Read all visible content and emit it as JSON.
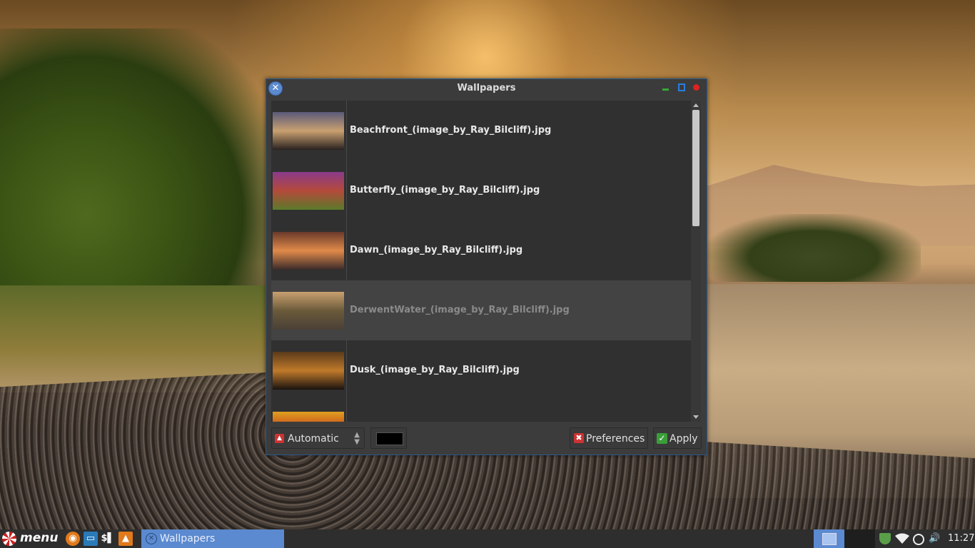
{
  "window": {
    "title": "Wallpapers",
    "controls": {
      "minimize": "minimize-icon",
      "maximize": "maximize-icon",
      "close": "close-icon"
    }
  },
  "wallpapers": [
    {
      "name": "Beachfront_(image_by_Ray_Bilcliff).jpg",
      "selected": false,
      "thumb_colors": [
        "#5a5a7a",
        "#c9a070",
        "#2a2220"
      ]
    },
    {
      "name": "Butterfly_(image_by_Ray_Bilcliff).jpg",
      "selected": false,
      "thumb_colors": [
        "#8a3a8a",
        "#b44a3a",
        "#5a7a2a"
      ]
    },
    {
      "name": "Dawn_(image_by_Ray_Bilcliff).jpg",
      "selected": false,
      "thumb_colors": [
        "#6a3a2a",
        "#e08a4a",
        "#3a2a2a"
      ]
    },
    {
      "name": "DerwentWater_(image_by_Ray_Bilcliff).jpg",
      "selected": true,
      "thumb_colors": [
        "#c9a070",
        "#6a5a3a",
        "#4a4036"
      ]
    },
    {
      "name": "Dusk_(image_by_Ray_Bilcliff).jpg",
      "selected": false,
      "thumb_colors": [
        "#5a3a1a",
        "#c07a2a",
        "#1a1210"
      ]
    },
    {
      "name": "",
      "selected": false,
      "thumb_colors": [
        "#e0a020",
        "#c03a1a",
        "#f0c040"
      ]
    }
  ],
  "bottombar": {
    "mode_select": {
      "value": "Automatic",
      "icon": "image-mode-icon"
    },
    "color_button": {
      "color": "#000000"
    },
    "preferences_label": "Preferences",
    "apply_label": "Apply"
  },
  "taskbar": {
    "menu_label": "menu",
    "launchers": [
      "firefox-icon",
      "file-manager-icon",
      "terminal-icon",
      "vlc-icon"
    ],
    "active_task": "Wallpapers",
    "workspaces": 2,
    "clock": "11:27"
  }
}
